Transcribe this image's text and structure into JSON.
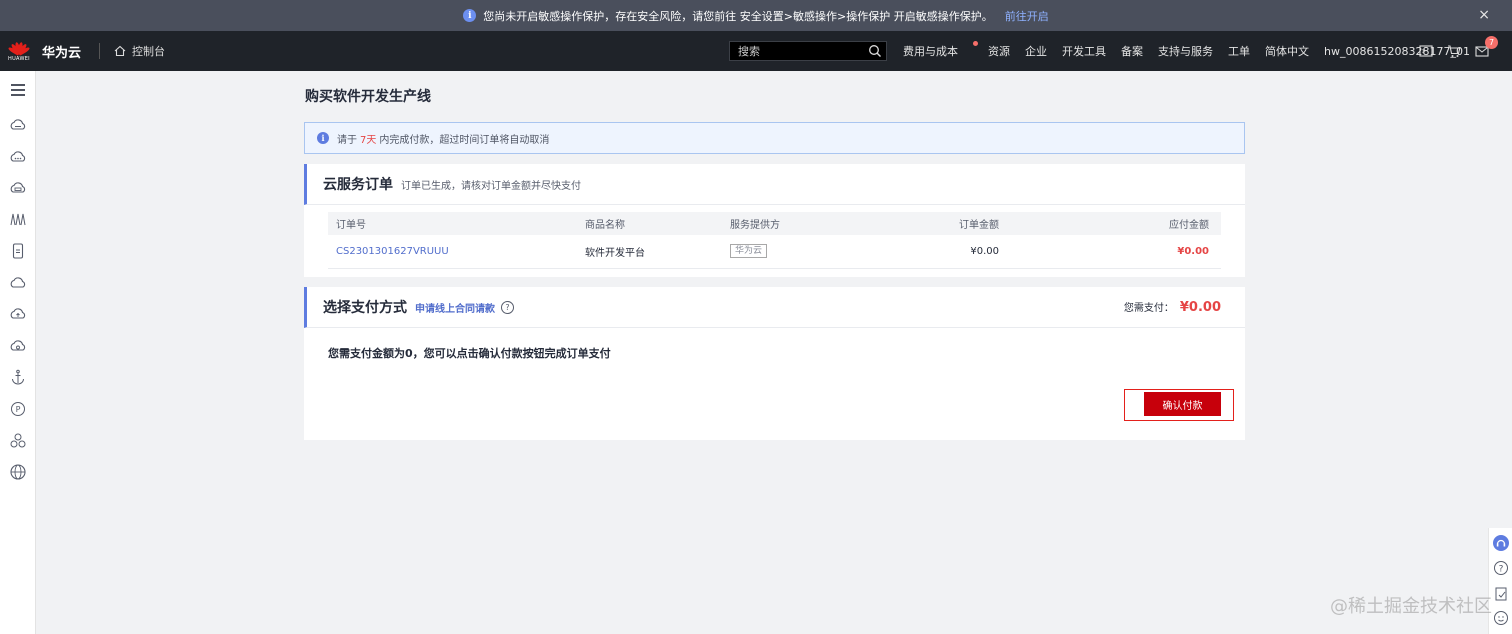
{
  "warning": {
    "text": "您尚未开启敏感操作保护，存在安全风险，请您前往 安全设置>敏感操作>操作保护 开启敏感操作保护。",
    "link": "前往开启",
    "info_glyph": "i",
    "close_glyph": "×"
  },
  "header": {
    "logo_label": "HUAWEI",
    "brand": "华为云",
    "console": "控制台",
    "search_placeholder": "搜索",
    "nav": [
      "费用与成本",
      "资源",
      "企业",
      "开发工具",
      "备案",
      "支持与服务",
      "工单",
      "简体中文",
      "hw_008615208328177_01"
    ],
    "message_count": "7"
  },
  "page": {
    "title": "购买软件开发生产线",
    "notice": {
      "icon": "i",
      "prefix": "请于",
      "days": "7天",
      "suffix": "内完成付款，超过时间订单将自动取消"
    }
  },
  "order_card": {
    "title": "云服务订单",
    "subtitle": "订单已生成，请核对订单金额并尽快支付",
    "columns": [
      "订单号",
      "商品名称",
      "服务提供方",
      "订单金额",
      "应付金额"
    ],
    "rows": [
      {
        "order_no": "CS2301301627VRUUU",
        "product": "软件开发平台",
        "provider": "华为云",
        "amount": "¥0.00",
        "payable": "¥0.00"
      }
    ]
  },
  "payment_card": {
    "title": "选择支付方式",
    "contract_link": "申请线上合同请款",
    "help_glyph": "?",
    "need_pay_label": "您需支付：",
    "need_pay_amount": "¥0.00",
    "zero_message": "您需支付金额为0，您可以点击确认付款按钮完成订单支付",
    "confirm_button": "确认付款"
  },
  "watermark": "@稀土掘金技术社区",
  "colors": {
    "accent": "#5e7ce0",
    "danger": "#e54545",
    "brand_red": "#c7000b",
    "header_bg": "#1f2329"
  }
}
